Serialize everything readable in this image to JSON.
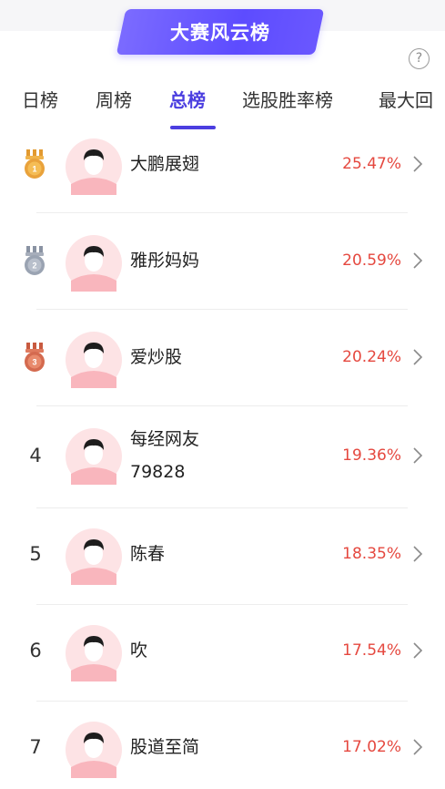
{
  "header": {
    "title": "大赛风云榜",
    "help_icon": "?"
  },
  "tabs": [
    {
      "label": "日榜"
    },
    {
      "label": "周榜"
    },
    {
      "label": "总榜"
    },
    {
      "label": "选股胜率榜"
    },
    {
      "label": "最大回"
    }
  ],
  "active_tab": "总榜",
  "ranking": [
    {
      "rank": "1",
      "name": "大鹏展翅",
      "rate": "25.47%",
      "medal": "gold"
    },
    {
      "rank": "2",
      "name": "雅彤妈妈",
      "rate": "20.59%",
      "medal": "silver"
    },
    {
      "rank": "3",
      "name": "爱炒股",
      "rate": "20.24%",
      "medal": "bronze"
    },
    {
      "rank": "4",
      "name_line1": "每经网友",
      "name_line2": "79828",
      "rate": "19.36%"
    },
    {
      "rank": "5",
      "name": "陈春",
      "rate": "18.35%"
    },
    {
      "rank": "6",
      "name": "吹",
      "rate": "17.54%"
    },
    {
      "rank": "7",
      "name": "股道至简",
      "rate": "17.02%"
    }
  ],
  "colors": {
    "accent": "#4b3ee0",
    "badge": "#6a57ff",
    "rate": "#e5483f",
    "gold": "#e9a23b",
    "silver": "#9aa3b2",
    "bronze": "#d46a4f"
  }
}
